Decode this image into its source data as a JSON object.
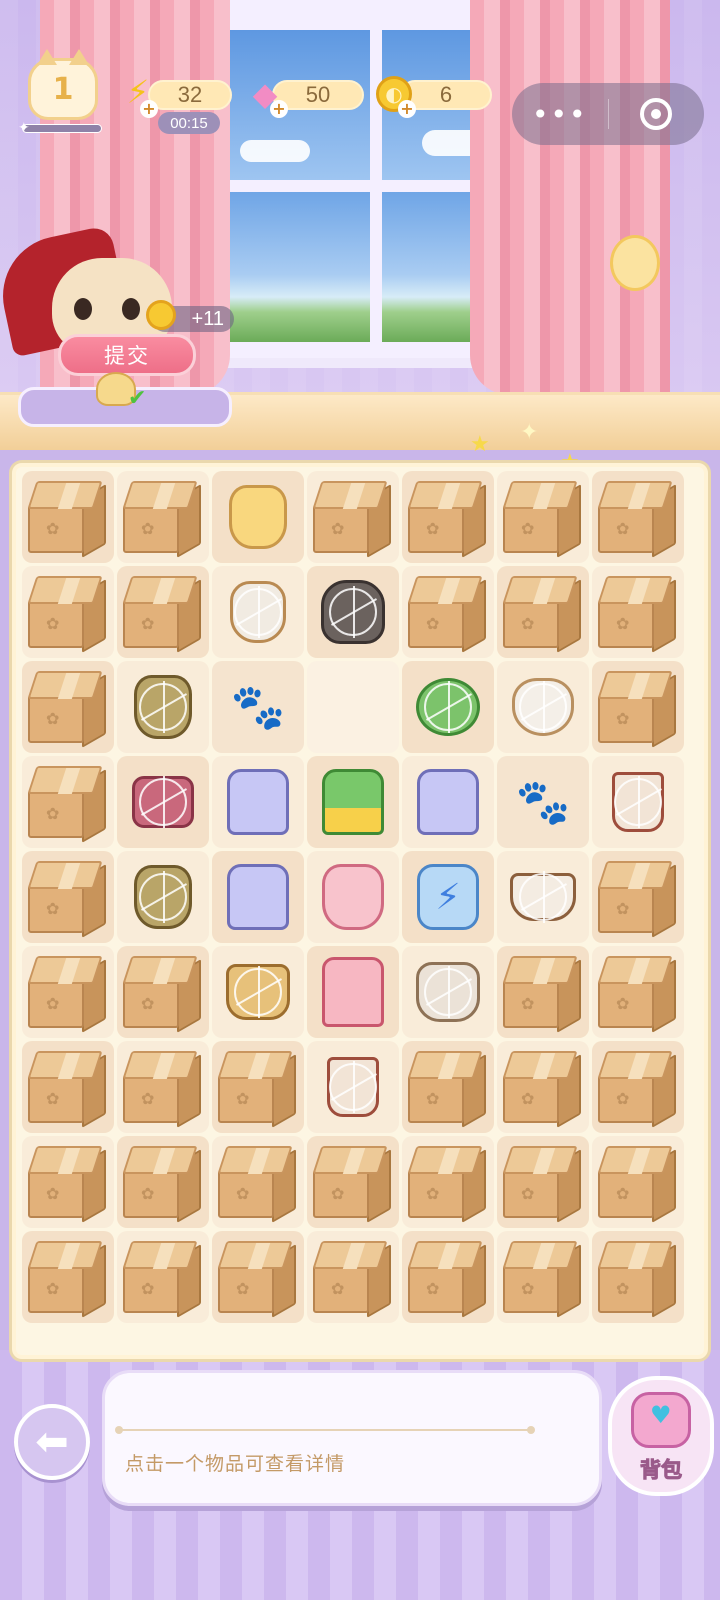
{
  "hud": {
    "level": "1",
    "energy": "32",
    "energy_timer": "00:15",
    "gems": "50",
    "coins": "6",
    "mini_more": "•••"
  },
  "order": {
    "reward": "+11",
    "submit_label": "提交",
    "status": "completed"
  },
  "board": {
    "rows": 9,
    "cols": 7,
    "cells": [
      [
        "box",
        "box",
        "dress-yellow",
        "box",
        "box",
        "box",
        "box"
      ],
      [
        "box",
        "box",
        "jug",
        "cat",
        "box",
        "box",
        "box"
      ],
      [
        "box",
        "dress-olive",
        "empty",
        "empty-plain",
        "cabbage",
        "teapot",
        "box"
      ],
      [
        "box",
        "cushion",
        "jacket",
        "sweater",
        "jacket",
        "empty",
        "cup-red"
      ],
      [
        "box",
        "dress-olive",
        "jacket",
        "dress-pink",
        "energy",
        "mug-coffee",
        "box"
      ],
      [
        "box",
        "box",
        "mug-tea",
        "robe-pink",
        "jar",
        "box",
        "box"
      ],
      [
        "box",
        "box",
        "box",
        "cup-red",
        "box",
        "box",
        "box"
      ],
      [
        "box",
        "box",
        "box",
        "box",
        "box",
        "box",
        "box"
      ],
      [
        "box",
        "box",
        "box",
        "box",
        "box",
        "box",
        "box"
      ]
    ],
    "webbed": [
      [
        0,
        0,
        0,
        0,
        0,
        0,
        0
      ],
      [
        0,
        0,
        1,
        1,
        0,
        0,
        0
      ],
      [
        0,
        1,
        0,
        0,
        1,
        1,
        0
      ],
      [
        0,
        1,
        0,
        0,
        0,
        0,
        1
      ],
      [
        0,
        1,
        0,
        0,
        0,
        1,
        0
      ],
      [
        0,
        0,
        1,
        0,
        1,
        0,
        0
      ],
      [
        0,
        0,
        0,
        1,
        0,
        0,
        0
      ],
      [
        0,
        0,
        0,
        0,
        0,
        0,
        0
      ],
      [
        0,
        0,
        0,
        0,
        0,
        0,
        0
      ]
    ]
  },
  "info_panel": {
    "hint": "点击一个物品可查看详情"
  },
  "bag": {
    "label": "背包"
  },
  "icons": {
    "energy": "lightning-icon",
    "gem": "gem-icon",
    "coin": "coin-icon",
    "back": "arrow-left-icon",
    "close": "target-circle-icon"
  }
}
